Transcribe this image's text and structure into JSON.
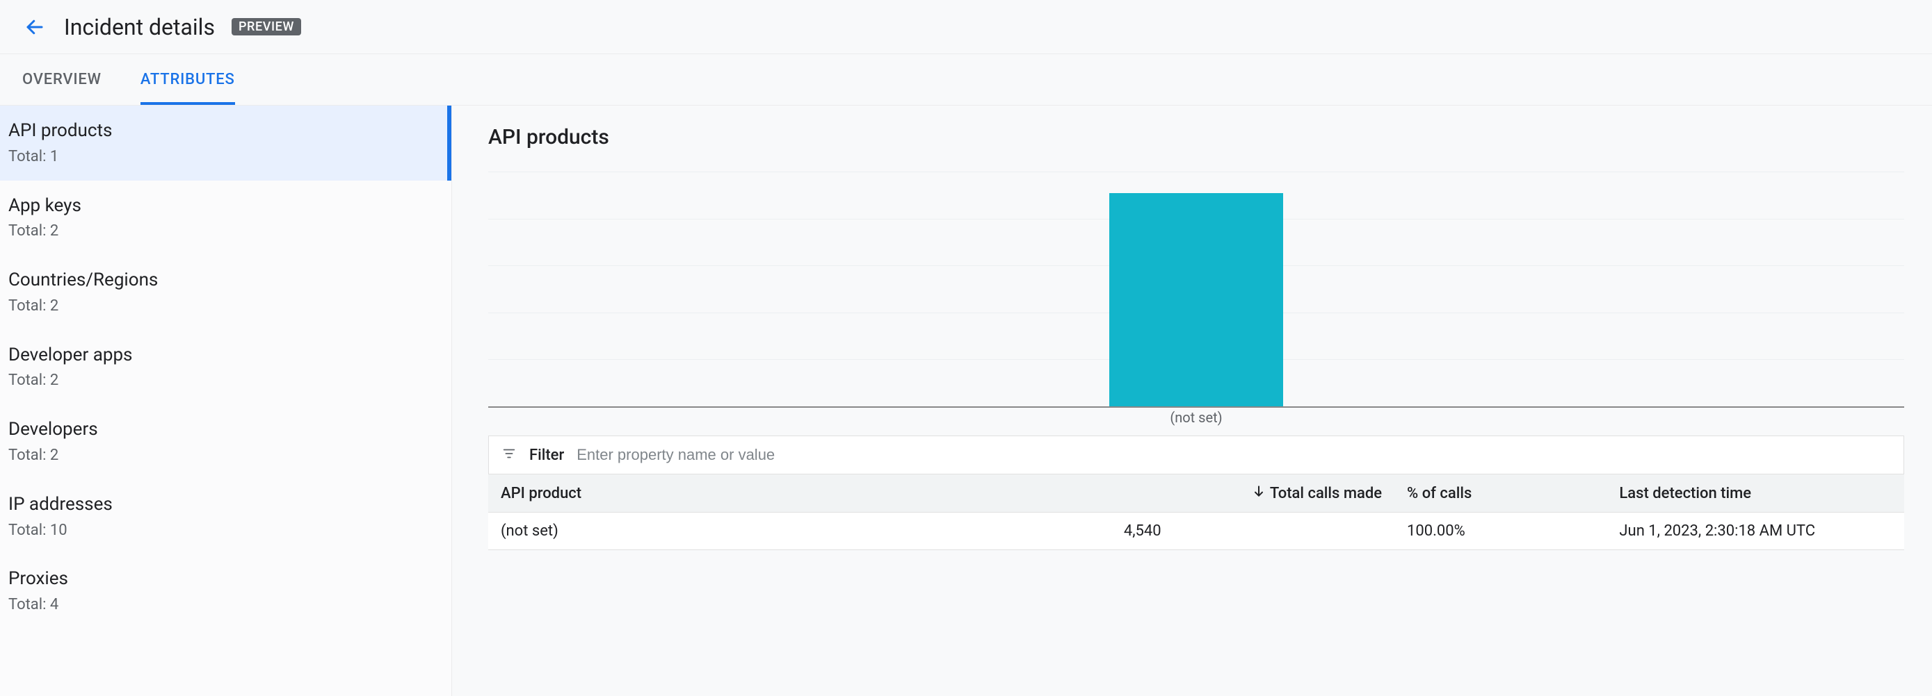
{
  "header": {
    "title": "Incident details",
    "badge": "PREVIEW"
  },
  "tabs": [
    {
      "label": "OVERVIEW",
      "active": false
    },
    {
      "label": "ATTRIBUTES",
      "active": true
    }
  ],
  "sidebar": {
    "total_prefix": "Total: ",
    "items": [
      {
        "title": "API products",
        "total": "1",
        "selected": true
      },
      {
        "title": "App keys",
        "total": "2",
        "selected": false
      },
      {
        "title": "Countries/Regions",
        "total": "2",
        "selected": false
      },
      {
        "title": "Developer apps",
        "total": "2",
        "selected": false
      },
      {
        "title": "Developers",
        "total": "2",
        "selected": false
      },
      {
        "title": "IP addresses",
        "total": "10",
        "selected": false
      },
      {
        "title": "Proxies",
        "total": "4",
        "selected": false
      }
    ]
  },
  "main": {
    "section_title": "API products",
    "filter": {
      "label": "Filter",
      "placeholder": "Enter property name or value"
    },
    "table": {
      "columns": {
        "product": "API product",
        "calls": "Total calls made",
        "pct": "% of calls",
        "last": "Last detection time"
      },
      "sort": {
        "column": "calls",
        "dir": "desc"
      },
      "rows": [
        {
          "product": "(not set)",
          "calls": "4,540",
          "pct": "100.00%",
          "last": "Jun 1, 2023, 2:30:18 AM UTC"
        }
      ]
    }
  },
  "chart_data": {
    "type": "bar",
    "categories": [
      "(not set)"
    ],
    "values": [
      4540
    ],
    "title": "API products",
    "xlabel": "",
    "ylabel": "Total calls made",
    "ylim": [
      0,
      5000
    ]
  }
}
